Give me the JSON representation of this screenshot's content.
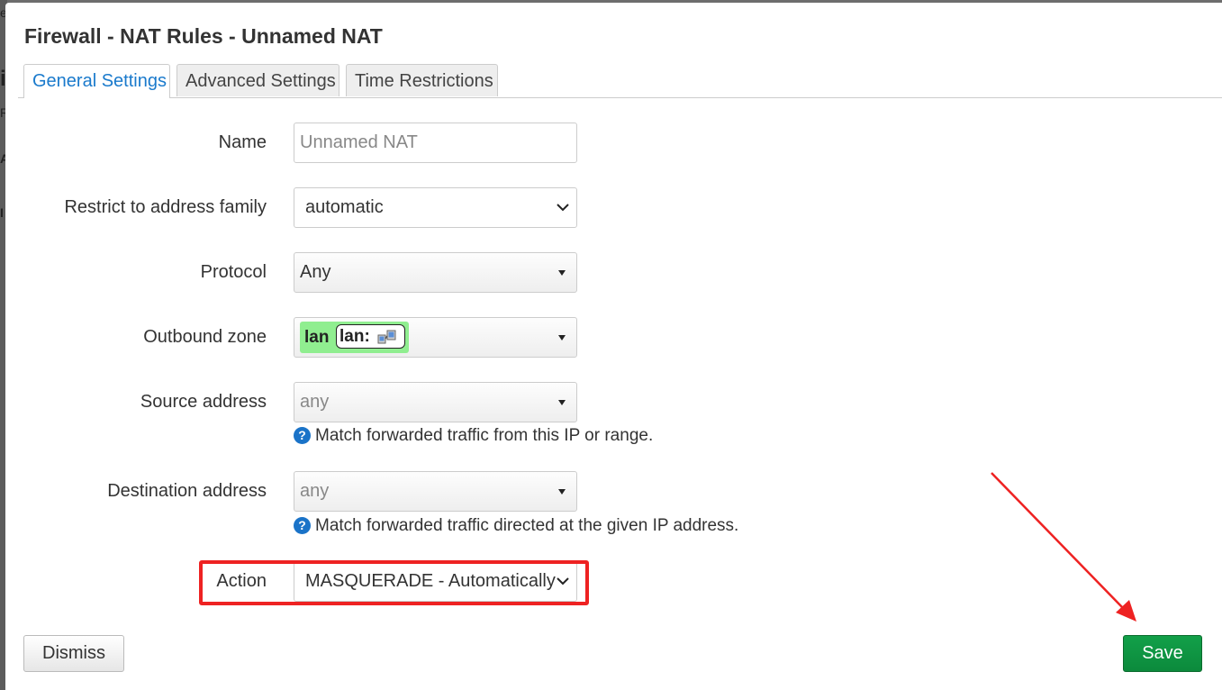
{
  "backdrop": {
    "glyphs": [
      "e",
      "i",
      "R",
      "A",
      "I"
    ]
  },
  "modal": {
    "title": "Firewall - NAT Rules - Unnamed NAT",
    "tabs": [
      {
        "label": "General Settings",
        "active": true
      },
      {
        "label": "Advanced Settings",
        "active": false
      },
      {
        "label": "Time Restrictions",
        "active": false
      }
    ]
  },
  "form": {
    "name": {
      "label": "Name",
      "placeholder": "Unnamed NAT"
    },
    "family": {
      "label": "Restrict to address family",
      "value": "automatic"
    },
    "protocol": {
      "label": "Protocol",
      "value": "Any"
    },
    "outbound": {
      "label": "Outbound zone",
      "zone_name": "lan",
      "zone_device": "lan:",
      "zone_color": "#90ee90",
      "device_icon": "network-devices-icon"
    },
    "source": {
      "label": "Source address",
      "value": "any",
      "help": "Match forwarded traffic from this IP or range."
    },
    "destination": {
      "label": "Destination address",
      "value": "any",
      "help": "Match forwarded traffic directed at the given IP address."
    },
    "action": {
      "label": "Action",
      "value": "MASQUERADE - Automatically"
    },
    "help_glyph": "?"
  },
  "footer": {
    "dismiss_label": "Dismiss",
    "save_label": "Save"
  },
  "annotations": {
    "highlight_color": "#ee2222",
    "arrow_color": "#ee2222"
  },
  "colors": {
    "accent": "#1a7acc",
    "save": "#0e9444",
    "help_icon": "#1a73c8"
  }
}
